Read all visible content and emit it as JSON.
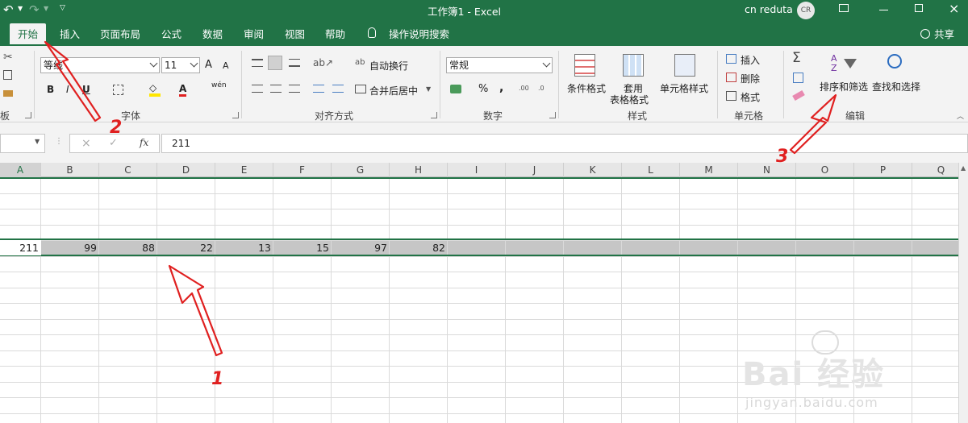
{
  "titlebar": {
    "doc_title": "工作簿1 - Excel",
    "user_name": "cn reduta",
    "avatar_initials": "CR"
  },
  "tabs": [
    {
      "label": "开始"
    },
    {
      "label": "插入"
    },
    {
      "label": "页面布局"
    },
    {
      "label": "公式"
    },
    {
      "label": "数据"
    },
    {
      "label": "审阅"
    },
    {
      "label": "视图"
    },
    {
      "label": "帮助"
    }
  ],
  "tell_me": "操作说明搜索",
  "share": "共享",
  "ribbon": {
    "font_group": {
      "font_name": "等线",
      "font_size": "11",
      "label": "字体",
      "grow": "A",
      "shrink": "A",
      "bold": "B",
      "italic": "I",
      "underline": "U",
      "font_color": "A",
      "phonetic": "wén"
    },
    "align_group": {
      "wrap": "自动换行",
      "merge": "合并后居中",
      "label": "对齐方式"
    },
    "number_group": {
      "format": "常规",
      "label": "数字",
      "percent": "%",
      "comma": ","
    },
    "styles_group": {
      "cond": "条件格式",
      "table_line1": "套用",
      "table_line2": "表格格式",
      "cell_styles": "单元格样式",
      "label": "样式"
    },
    "cells_group": {
      "insert": "插入",
      "delete": "删除",
      "format": "格式",
      "label": "单元格"
    },
    "editing_group": {
      "sort": "排序和筛选",
      "find": "查找和选择",
      "label": "编辑"
    },
    "clipboard_group": {
      "label": "板"
    }
  },
  "formula": {
    "content": "211",
    "fx": "fx"
  },
  "columns": [
    "A",
    "B",
    "C",
    "D",
    "E",
    "F",
    "G",
    "H",
    "I",
    "J",
    "K",
    "L",
    "M",
    "N",
    "O",
    "P",
    "Q"
  ],
  "row_values": [
    "211",
    "99",
    "88",
    "22",
    "13",
    "15",
    "97",
    "82"
  ],
  "annotations": {
    "n1": "1",
    "n2": "2",
    "n3": "3"
  },
  "watermark": {
    "brand_text": "Bai 经验",
    "url": "jingyan.baidu.com"
  },
  "colors": {
    "excel_green": "#217346",
    "arrow_red": "#e02020"
  }
}
